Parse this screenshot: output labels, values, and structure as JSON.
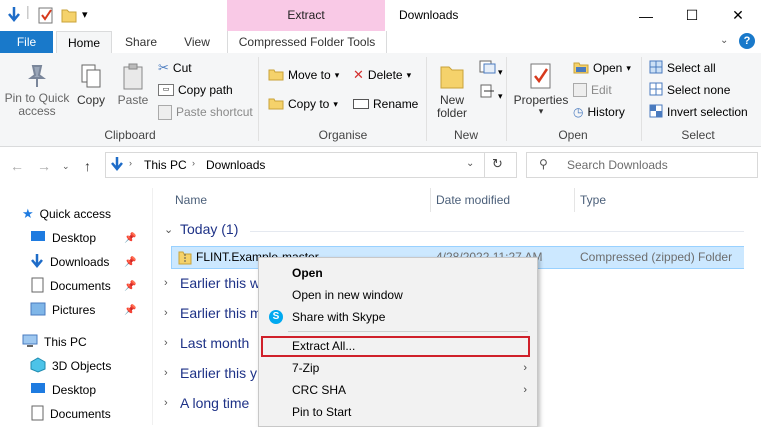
{
  "window": {
    "title": "Downloads",
    "context_tab": "Extract"
  },
  "tabs": {
    "file": "File",
    "home": "Home",
    "share": "Share",
    "view": "View",
    "compressed": "Compressed Folder Tools"
  },
  "ribbon": {
    "clipboard": {
      "label": "Clipboard",
      "pin": "Pin to Quick access",
      "copy": "Copy",
      "paste": "Paste",
      "cut": "Cut",
      "copy_path": "Copy path",
      "paste_shortcut": "Paste shortcut"
    },
    "organise": {
      "label": "Organise",
      "move_to": "Move to",
      "copy_to": "Copy to",
      "delete": "Delete",
      "rename": "Rename"
    },
    "new": {
      "label": "New",
      "new_folder": "New folder"
    },
    "open": {
      "label": "Open",
      "properties": "Properties",
      "open": "Open",
      "edit": "Edit",
      "history": "History"
    },
    "select": {
      "label": "Select",
      "select_all": "Select all",
      "select_none": "Select none",
      "invert": "Invert selection"
    }
  },
  "address": {
    "path1": "This PC",
    "path2": "Downloads",
    "search_placeholder": "Search Downloads"
  },
  "nav": {
    "quick_access": "Quick access",
    "items": [
      "Desktop",
      "Downloads",
      "Documents",
      "Pictures"
    ],
    "this_pc": "This PC",
    "pc_items": [
      "3D Objects",
      "Desktop",
      "Documents"
    ]
  },
  "columns": {
    "name": "Name",
    "date": "Date modified",
    "type": "Type"
  },
  "groups": {
    "today": "Today (1)",
    "g2": "Earlier this w",
    "g3": "Earlier this m",
    "g4": "Last month",
    "g5": "Earlier this y",
    "g6": "A long time"
  },
  "file": {
    "name": "FLINT.Example-master",
    "date": "4/28/2022 11:27 AM",
    "type": "Compressed (zipped) Folder"
  },
  "context_menu": {
    "open": "Open",
    "open_new_window": "Open in new window",
    "share_skype": "Share with Skype",
    "extract_all": "Extract All...",
    "seven_zip": "7-Zip",
    "crc_sha": "CRC SHA",
    "pin_start": "Pin to Start"
  },
  "colors": {
    "accent": "#1979ca",
    "extract_tab": "#f9c9e6",
    "selection": "#cce8ff",
    "highlight_border": "#d0202a"
  }
}
